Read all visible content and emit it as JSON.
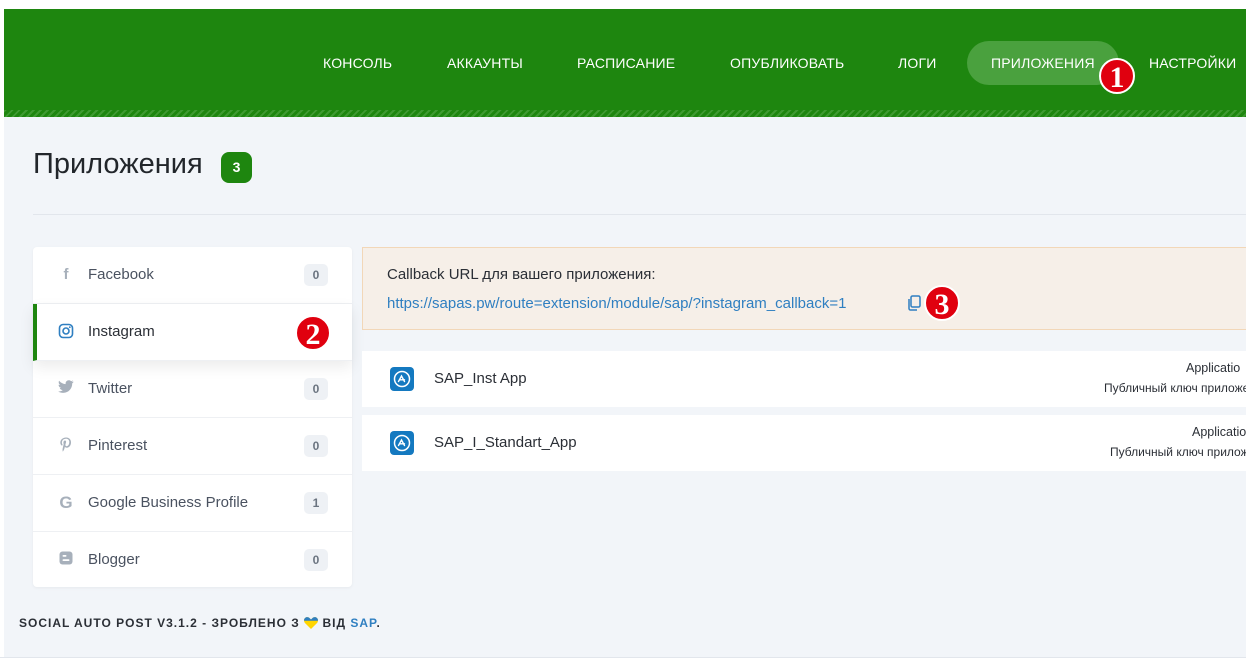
{
  "nav": {
    "items": [
      {
        "label": "КОНСОЛЬ"
      },
      {
        "label": "АККАУНТЫ"
      },
      {
        "label": "РАСПИСАНИЕ"
      },
      {
        "label": "ОПУБЛИКОВАТЬ"
      },
      {
        "label": "ЛОГИ"
      },
      {
        "label": "ПРИЛОЖЕНИЯ",
        "active": true
      },
      {
        "label": "НАСТРОЙКИ"
      }
    ]
  },
  "markers": [
    "1",
    "2",
    "3"
  ],
  "page": {
    "title": "Приложения",
    "count": "3"
  },
  "sidebar": {
    "items": [
      {
        "label": "Facebook",
        "count": "0",
        "icon": "facebook-icon"
      },
      {
        "label": "Instagram",
        "count": "",
        "icon": "instagram-icon",
        "active": true
      },
      {
        "label": "Twitter",
        "count": "0",
        "icon": "twitter-icon"
      },
      {
        "label": "Pinterest",
        "count": "0",
        "icon": "pinterest-icon"
      },
      {
        "label": "Google Business Profile",
        "count": "1",
        "icon": "google-icon"
      },
      {
        "label": "Blogger",
        "count": "0",
        "icon": "blogger-icon"
      }
    ]
  },
  "callback": {
    "label": "Callback URL для вашего приложения:",
    "url": "https://sapas.pw/route=extension/module/sap/?instagram_callback=1"
  },
  "apps": [
    {
      "name": "SAP_Inst App",
      "meta_title": "Applicatio",
      "meta_sub": "Публичный ключ приложе"
    },
    {
      "name": "SAP_I_Standart_App",
      "meta_title": "Applicatio",
      "meta_sub": "Публичный ключ прилож"
    }
  ],
  "footer": {
    "text": "SOCIAL AUTO POST V3.1.2 - ЗРОБЛЕНО З",
    "text2": "ВІД",
    "link": "SAP",
    "dot": "."
  },
  "colors": {
    "brand_green": "#1e860f",
    "active_pill": "#4aa13e",
    "link_blue": "#2f7fc1",
    "marker_red": "#e0000f"
  }
}
